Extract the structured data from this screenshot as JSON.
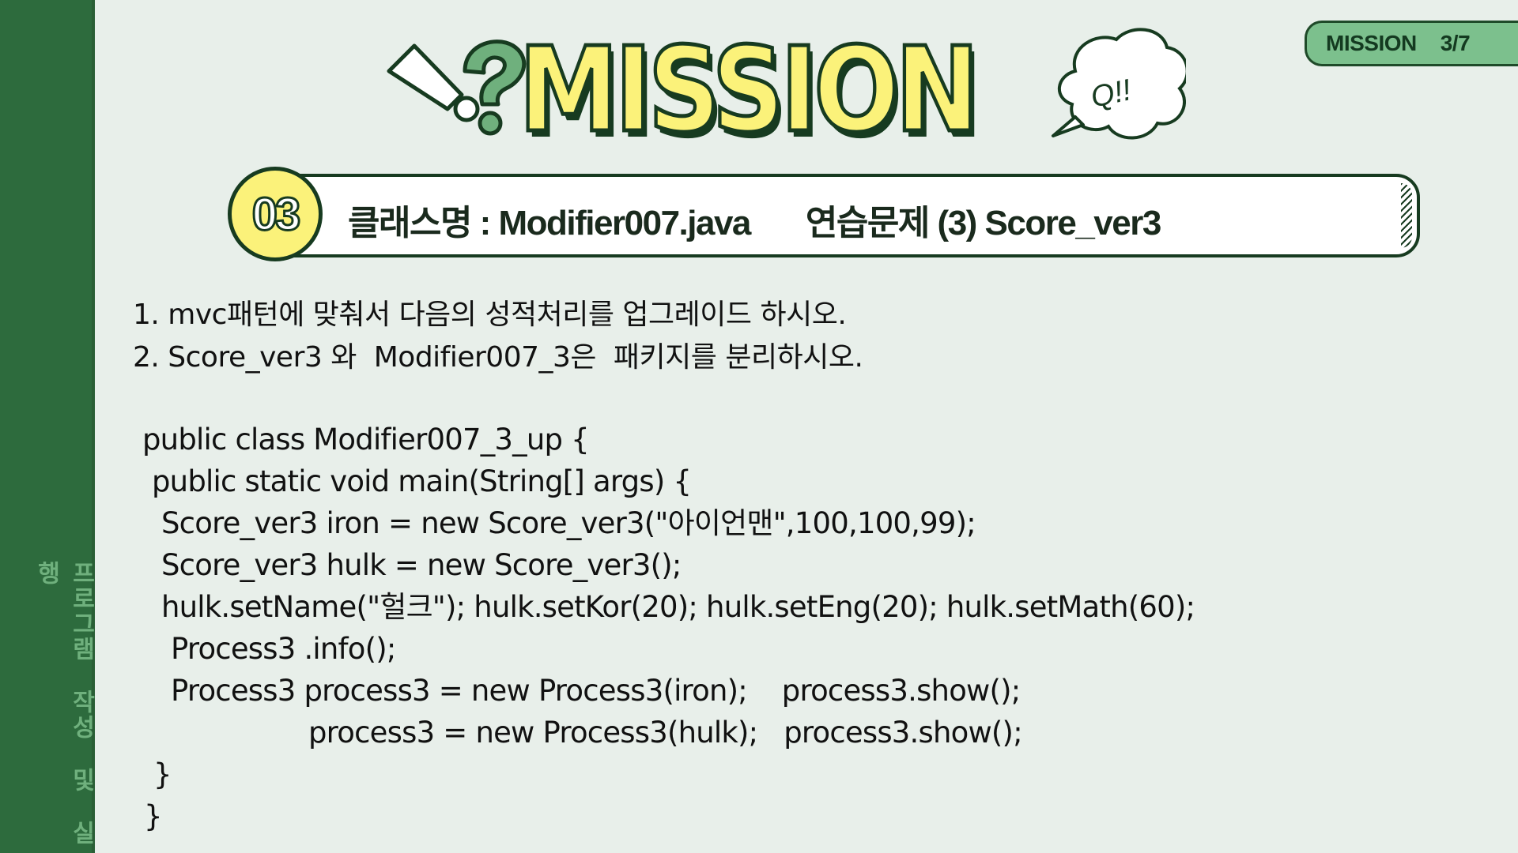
{
  "sidebar": {
    "label": "프로그램 작성 및 실행"
  },
  "mission_tab": {
    "label": "MISSION",
    "progress": "3/7"
  },
  "banner": {
    "title": "MISSION",
    "cloud_text": "Q!!"
  },
  "exercise": {
    "number": "03",
    "class_name": "클래스명 : Modifier007.java",
    "problem": "연습문제 (3) Score_ver3"
  },
  "instructions": [
    "1. mvc패턴에 맞춰서 다음의 성적처리를 업그레이드 하시오.",
    "2. Score_ver3 와  Modifier007_3은  패키지를 분리하시오."
  ],
  "code": [
    "public class Modifier007_3_up {",
    "public static void main(String[] args) {",
    "Score_ver3 iron = new Score_ver3(\"아이언맨\",100,100,99);",
    "Score_ver3 hulk = new Score_ver3();",
    "hulk.setName(\"헐크\"); hulk.setKor(20); hulk.setEng(20); hulk.setMath(60);",
    "Process3 .info();",
    "Process3 process3 = new Process3(iron);    process3.show();",
    "process3 = new Process3(hulk);   process3.show();",
    "}",
    "}"
  ]
}
